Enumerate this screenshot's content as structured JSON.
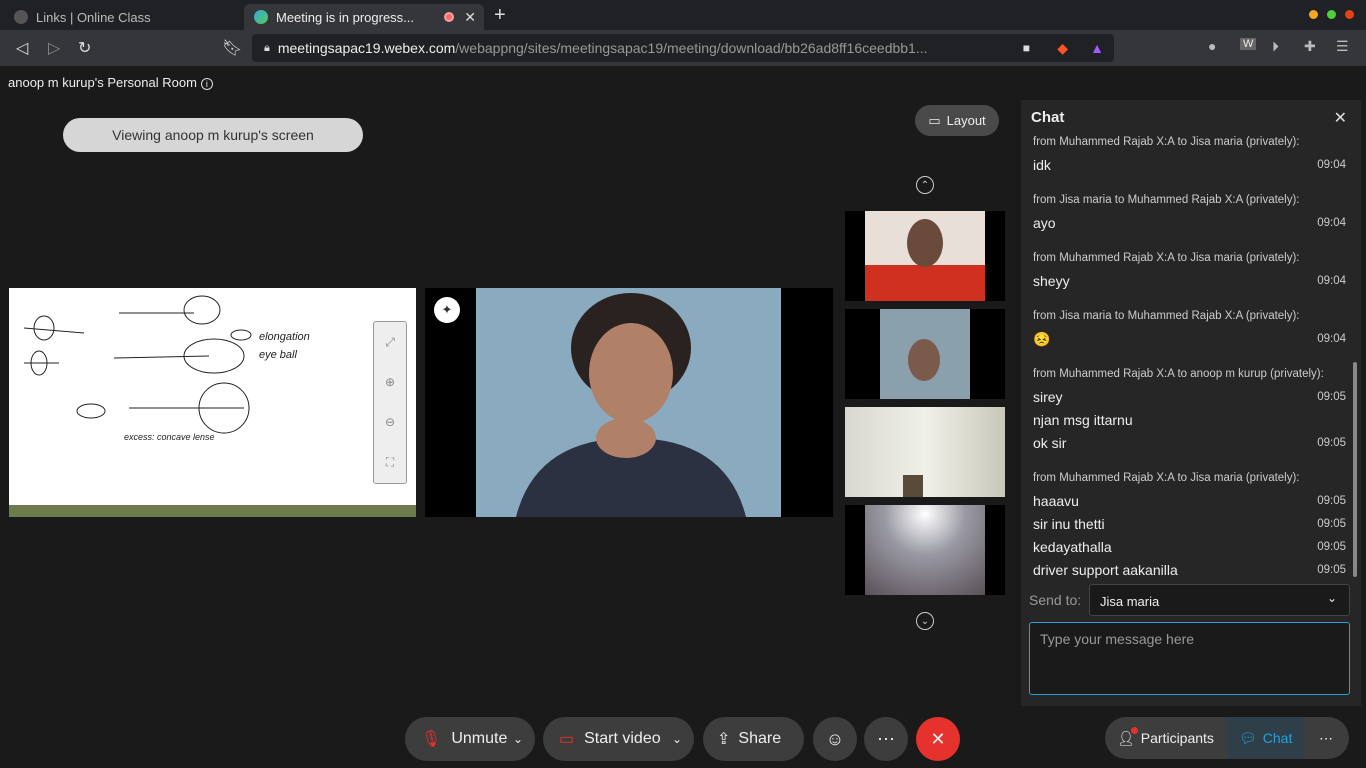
{
  "browser": {
    "tab1_title": "Links | Online Class",
    "tab2_title": "Meeting is in progress...",
    "url_host": "meetingsapac19.webex.com",
    "url_path": "/webappng/sites/meetingsapac19/meeting/download/bb26ad8ff16ceedbb1...",
    "icons": [
      "back-icon",
      "forward-icon",
      "reload-icon",
      "bookmark-icon",
      "lock-icon",
      "camera-icon",
      "brave-icon",
      "rewards-icon",
      "extensions-icon",
      "menu-icon"
    ]
  },
  "meeting": {
    "room_name": "anoop m kurup's Personal Room",
    "viewing_label": "Viewing anoop m kurup's screen",
    "layout_label": "Layout"
  },
  "chat": {
    "title": "Chat",
    "groups": [
      {
        "header": "from Muhammed Rajab X:A to Jisa maria (privately):",
        "messages": [
          {
            "text": "idk",
            "time": "09:04"
          }
        ]
      },
      {
        "header": "from Jisa maria to Muhammed Rajab X:A (privately):",
        "messages": [
          {
            "text": "ayo",
            "time": "09:04"
          }
        ]
      },
      {
        "header": "from Muhammed Rajab X:A to Jisa maria (privately):",
        "messages": [
          {
            "text": "sheyy",
            "time": "09:04"
          }
        ]
      },
      {
        "header": "from Jisa maria to Muhammed Rajab X:A (privately):",
        "messages": [
          {
            "text": "😣",
            "time": "09:04"
          }
        ]
      },
      {
        "header": "from Muhammed Rajab X:A to anoop m kurup (privately):",
        "messages": [
          {
            "text": "sirey",
            "time": "09:05"
          },
          {
            "text": "njan msg ittarnu",
            "time": ""
          },
          {
            "text": "ok sir",
            "time": "09:05"
          }
        ]
      },
      {
        "header": "from Muhammed Rajab X:A to Jisa maria (privately):",
        "messages": [
          {
            "text": "haaavu",
            "time": "09:05"
          },
          {
            "text": "sir inu thetti",
            "time": "09:05"
          },
          {
            "text": "kedayathalla",
            "time": "09:05"
          },
          {
            "text": "driver support aakanilla",
            "time": "09:05"
          }
        ]
      }
    ],
    "send_to_label": "Send to:",
    "send_to_value": "Jisa maria",
    "input_placeholder": "Type your message here"
  },
  "controls": {
    "unmute": "Unmute",
    "start_video": "Start video",
    "share": "Share",
    "participants": "Participants",
    "chat": "Chat"
  },
  "colors": {
    "end_call": "#e5322d",
    "chat_accent": "#2a9fd8"
  }
}
